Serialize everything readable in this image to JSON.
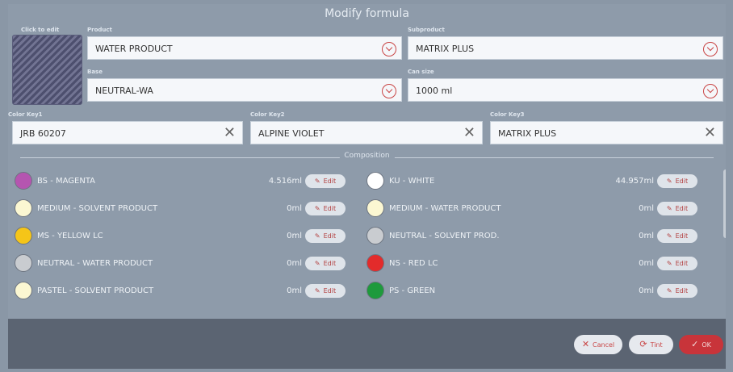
{
  "title": "Modify formula",
  "swatch_label": "Click to edit",
  "product": {
    "label": "Product",
    "value": "WATER PRODUCT"
  },
  "subproduct": {
    "label": "Subproduct",
    "value": "MATRIX PLUS"
  },
  "base": {
    "label": "Base",
    "value": "NEUTRAL-WA"
  },
  "can_size": {
    "label": "Can size",
    "value": "1000 ml"
  },
  "color_key1": {
    "label": "Color Key1",
    "value": "JRB 60207"
  },
  "color_key2": {
    "label": "Color Key2",
    "value": "ALPINE VIOLET"
  },
  "color_key3": {
    "label": "Color Key3",
    "value": "MATRIX PLUS"
  },
  "composition_label": "Composition",
  "edit_label": "Edit",
  "left_items": [
    {
      "name": "BS - MAGENTA",
      "qty": "4.516ml",
      "color": "#b555b0"
    },
    {
      "name": "MEDIUM - SOLVENT PRODUCT",
      "qty": "0ml",
      "color": "#fbf7d2"
    },
    {
      "name": "MS - YELLOW LC",
      "qty": "0ml",
      "color": "#f5c518"
    },
    {
      "name": "NEUTRAL - WATER PRODUCT",
      "qty": "0ml",
      "color": "#c9ccd0"
    },
    {
      "name": "PASTEL - SOLVENT PRODUCT",
      "qty": "0ml",
      "color": "#fbf7d2"
    }
  ],
  "right_items": [
    {
      "name": "KU - WHITE",
      "qty": "44.957ml",
      "color": "#ffffff"
    },
    {
      "name": "MEDIUM - WATER PRODUCT",
      "qty": "0ml",
      "color": "#fbf7d2"
    },
    {
      "name": "NEUTRAL - SOLVENT PROD.",
      "qty": "0ml",
      "color": "#c9ccd0"
    },
    {
      "name": "NS - RED LC",
      "qty": "0ml",
      "color": "#e32b2b"
    },
    {
      "name": "PS - GREEN",
      "qty": "0ml",
      "color": "#1e9a3c"
    }
  ],
  "footer": {
    "cancel": "Cancel",
    "tint": "Tint",
    "ok": "OK"
  },
  "colors": {
    "accent": "#c94545",
    "ok_bg": "#c8343a"
  },
  "icons": {
    "chevron": "chevron-down-circle-icon",
    "clear": "close-icon",
    "edit": "pencil-icon",
    "tint": "drop-icon",
    "ok": "check-icon"
  }
}
